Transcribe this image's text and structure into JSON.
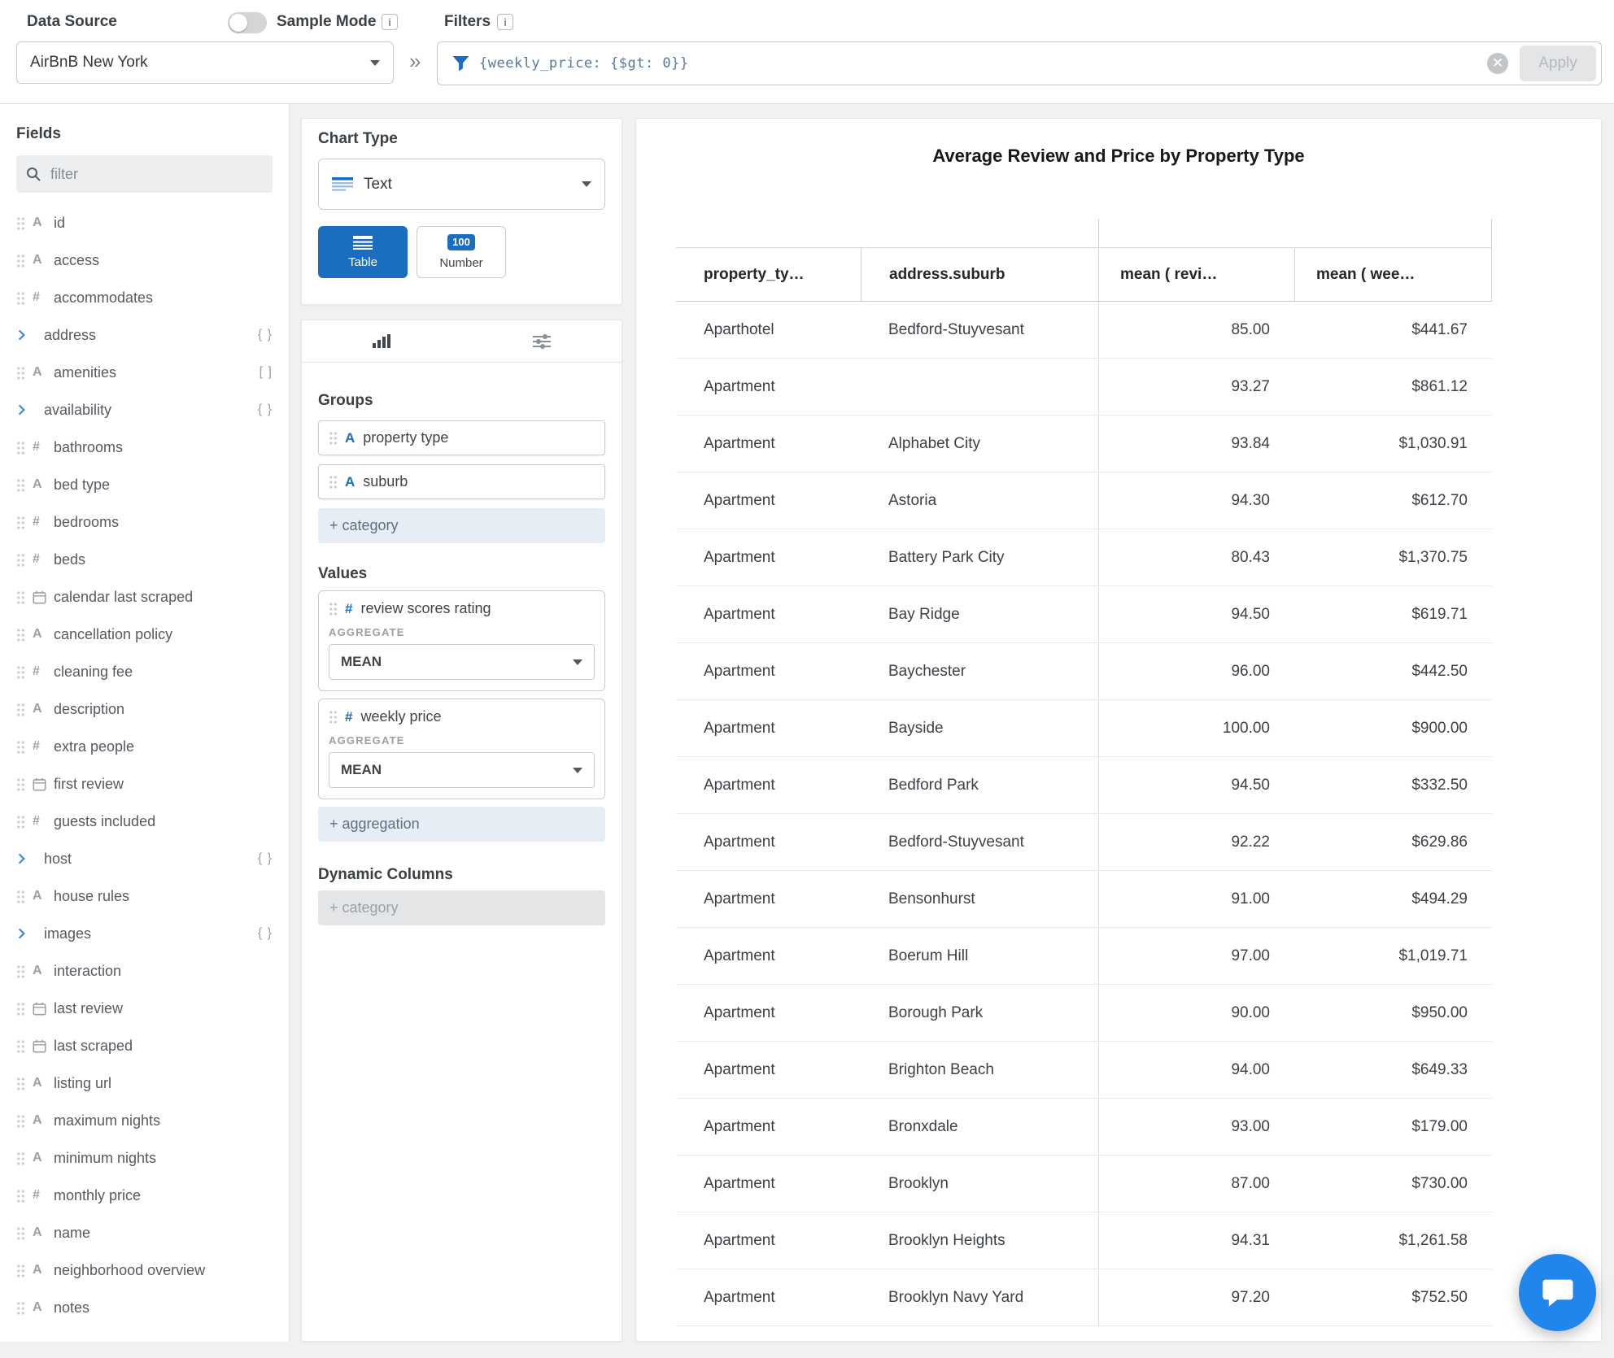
{
  "topbar": {
    "data_source_label": "Data Source",
    "sample_mode_label": "Sample Mode",
    "filters_label": "Filters",
    "data_source_value": "AirBnB New York",
    "filter_query": "{weekly_price: {$gt: 0}}",
    "apply_label": "Apply"
  },
  "fields": {
    "title": "Fields",
    "search_placeholder": "filter",
    "items": [
      {
        "label": "id",
        "type": "string"
      },
      {
        "label": "access",
        "type": "string"
      },
      {
        "label": "accommodates",
        "type": "number"
      },
      {
        "label": "address",
        "type": "object",
        "badge": "{ }"
      },
      {
        "label": "amenities",
        "type": "string",
        "badge": "[ ]"
      },
      {
        "label": "availability",
        "type": "object",
        "badge": "{ }"
      },
      {
        "label": "bathrooms",
        "type": "number"
      },
      {
        "label": "bed type",
        "type": "string"
      },
      {
        "label": "bedrooms",
        "type": "number"
      },
      {
        "label": "beds",
        "type": "number"
      },
      {
        "label": "calendar last scraped",
        "type": "date"
      },
      {
        "label": "cancellation policy",
        "type": "string"
      },
      {
        "label": "cleaning fee",
        "type": "number"
      },
      {
        "label": "description",
        "type": "string"
      },
      {
        "label": "extra people",
        "type": "number"
      },
      {
        "label": "first review",
        "type": "date"
      },
      {
        "label": "guests included",
        "type": "number"
      },
      {
        "label": "host",
        "type": "object",
        "badge": "{ }"
      },
      {
        "label": "house rules",
        "type": "string"
      },
      {
        "label": "images",
        "type": "object",
        "badge": "{ }"
      },
      {
        "label": "interaction",
        "type": "string"
      },
      {
        "label": "last review",
        "type": "date"
      },
      {
        "label": "last scraped",
        "type": "date"
      },
      {
        "label": "listing url",
        "type": "string"
      },
      {
        "label": "maximum nights",
        "type": "string"
      },
      {
        "label": "minimum nights",
        "type": "string"
      },
      {
        "label": "monthly price",
        "type": "number"
      },
      {
        "label": "name",
        "type": "string"
      },
      {
        "label": "neighborhood overview",
        "type": "string"
      },
      {
        "label": "notes",
        "type": "string"
      }
    ]
  },
  "builder": {
    "chart_type_label": "Chart Type",
    "chart_type_value": "Text",
    "table_label": "Table",
    "number_label": "Number",
    "number_badge": "100",
    "groups_label": "Groups",
    "group_chips": [
      "property type",
      "suburb"
    ],
    "add_category_label": "+ category",
    "values_label": "Values",
    "value_cards": [
      {
        "field": "review scores rating",
        "aggregate_label": "AGGREGATE",
        "aggregate_value": "MEAN"
      },
      {
        "field": "weekly price",
        "aggregate_label": "AGGREGATE",
        "aggregate_value": "MEAN"
      }
    ],
    "add_aggregation_label": "+ aggregation",
    "dynamic_columns_label": "Dynamic Columns",
    "dynamic_add_category_label": "+ category"
  },
  "accent_colors": {
    "primary_blue": "#1a6dc0",
    "launcher_blue": "#2186eb"
  },
  "chart_data": {
    "type": "table",
    "title": "Average Review and Price by Property Type",
    "columns": [
      "property_ty…",
      "address.suburb",
      "mean ( revi…",
      "mean ( wee…"
    ],
    "rows": [
      [
        "Aparthotel",
        "Bedford-Stuyvesant",
        "85.00",
        "$441.67"
      ],
      [
        "Apartment",
        "",
        "93.27",
        "$861.12"
      ],
      [
        "Apartment",
        "Alphabet City",
        "93.84",
        "$1,030.91"
      ],
      [
        "Apartment",
        "Astoria",
        "94.30",
        "$612.70"
      ],
      [
        "Apartment",
        "Battery Park City",
        "80.43",
        "$1,370.75"
      ],
      [
        "Apartment",
        "Bay Ridge",
        "94.50",
        "$619.71"
      ],
      [
        "Apartment",
        "Baychester",
        "96.00",
        "$442.50"
      ],
      [
        "Apartment",
        "Bayside",
        "100.00",
        "$900.00"
      ],
      [
        "Apartment",
        "Bedford Park",
        "94.50",
        "$332.50"
      ],
      [
        "Apartment",
        "Bedford-Stuyvesant",
        "92.22",
        "$629.86"
      ],
      [
        "Apartment",
        "Bensonhurst",
        "91.00",
        "$494.29"
      ],
      [
        "Apartment",
        "Boerum Hill",
        "97.00",
        "$1,019.71"
      ],
      [
        "Apartment",
        "Borough Park",
        "90.00",
        "$950.00"
      ],
      [
        "Apartment",
        "Brighton Beach",
        "94.00",
        "$649.33"
      ],
      [
        "Apartment",
        "Bronxdale",
        "93.00",
        "$179.00"
      ],
      [
        "Apartment",
        "Brooklyn",
        "87.00",
        "$730.00"
      ],
      [
        "Apartment",
        "Brooklyn Heights",
        "94.31",
        "$1,261.58"
      ],
      [
        "Apartment",
        "Brooklyn Navy Yard",
        "97.20",
        "$752.50"
      ]
    ]
  }
}
